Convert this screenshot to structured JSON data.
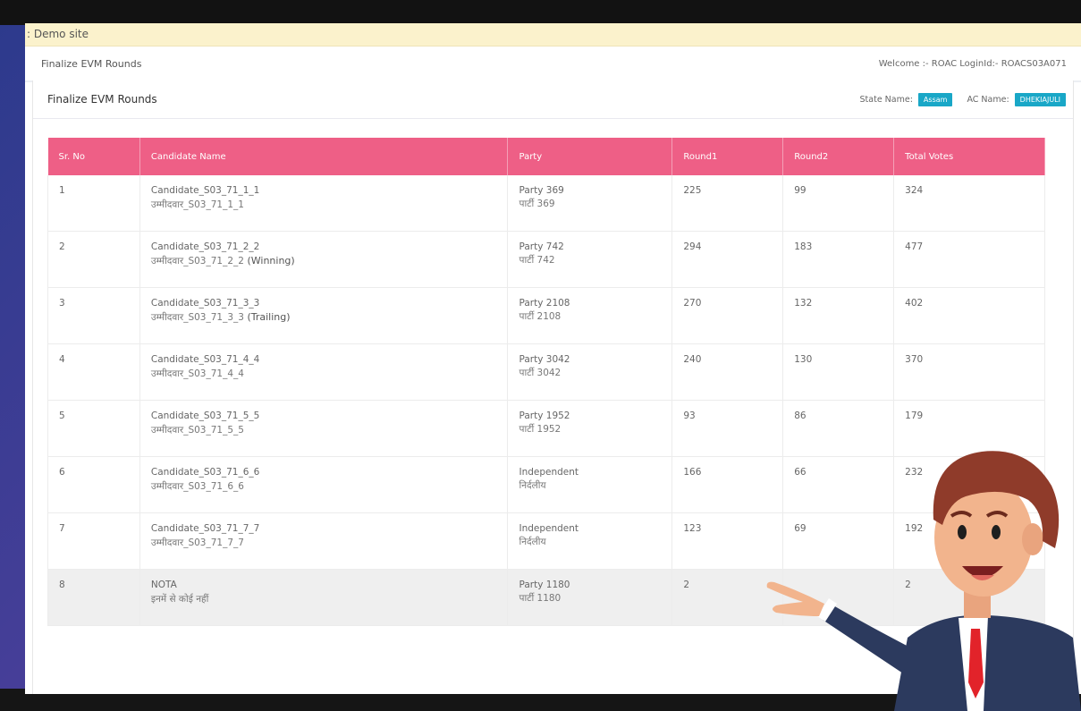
{
  "demo_banner": ": Demo site",
  "topbar": {
    "page_name": "Finalize EVM Rounds",
    "welcome": "Welcome :- ROAC LoginId:- ROACS03A071"
  },
  "card": {
    "title": "Finalize EVM Rounds",
    "state_label": "State Name:",
    "state_value": "Assam",
    "ac_label": "AC Name:",
    "ac_value": "DHEKIAJULI"
  },
  "table": {
    "headers": [
      "Sr. No",
      "Candidate Name",
      "Party",
      "Round1",
      "Round2",
      "Total Votes"
    ],
    "rows": [
      {
        "sr": "1",
        "name": "Candidate_S03_71_1_1",
        "name_hi": "उम्मीदवार_S03_71_1_1",
        "status": "",
        "party": "Party 369",
        "party_hi": "पार्टी 369",
        "r1": "225",
        "r2": "99",
        "total": "324"
      },
      {
        "sr": "2",
        "name": "Candidate_S03_71_2_2",
        "name_hi": "उम्मीदवार_S03_71_2_2",
        "status": " (Winning)",
        "party": "Party 742",
        "party_hi": "पार्टी 742",
        "r1": "294",
        "r2": "183",
        "total": "477"
      },
      {
        "sr": "3",
        "name": "Candidate_S03_71_3_3",
        "name_hi": "उम्मीदवार_S03_71_3_3",
        "status": " (Trailing)",
        "party": "Party 2108",
        "party_hi": "पार्टी 2108",
        "r1": "270",
        "r2": "132",
        "total": "402"
      },
      {
        "sr": "4",
        "name": "Candidate_S03_71_4_4",
        "name_hi": "उम्मीदवार_S03_71_4_4",
        "status": "",
        "party": "Party 3042",
        "party_hi": "पार्टी 3042",
        "r1": "240",
        "r2": "130",
        "total": "370"
      },
      {
        "sr": "5",
        "name": "Candidate_S03_71_5_5",
        "name_hi": "उम्मीदवार_S03_71_5_5",
        "status": "",
        "party": "Party 1952",
        "party_hi": "पार्टी 1952",
        "r1": "93",
        "r2": "86",
        "total": "179"
      },
      {
        "sr": "6",
        "name": "Candidate_S03_71_6_6",
        "name_hi": "उम्मीदवार_S03_71_6_6",
        "status": "",
        "party": "Independent",
        "party_hi": "निर्दलीय",
        "r1": "166",
        "r2": "66",
        "total": "232"
      },
      {
        "sr": "7",
        "name": "Candidate_S03_71_7_7",
        "name_hi": "उम्मीदवार_S03_71_7_7",
        "status": "",
        "party": "Independent",
        "party_hi": "निर्दलीय",
        "r1": "123",
        "r2": "69",
        "total": "192"
      },
      {
        "sr": "8",
        "name": "NOTA",
        "name_hi": "इनमें से कोई नहीं",
        "status": "",
        "party": "Party 1180",
        "party_hi": "पार्टी 1180",
        "r1": "2",
        "r2": "",
        "total": "2"
      }
    ]
  },
  "colors": {
    "header_pink": "#ee5f86",
    "pill_blue": "#19a7c7",
    "banner_yellow": "#fbf2cc"
  }
}
